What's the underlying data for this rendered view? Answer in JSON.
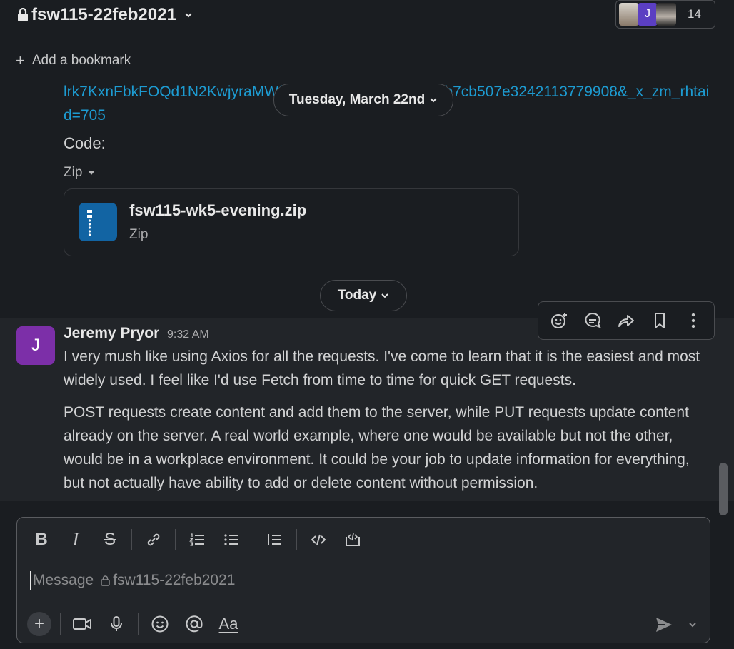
{
  "channel": {
    "name": "fsw115-22feb2021",
    "member_count": "14"
  },
  "bookmark": {
    "add_label": "Add a bookmark"
  },
  "messages_area": {
    "link_text": "lrk7KxnFbkFOQd1N2KwjyraMWfmd9995017fdf197a54c5b7cb507e3242113779908&_x_zm_rhtaid=705",
    "date_divider_1": "Tuesday, March 22nd",
    "code_label": "Code:",
    "attachment_kind": "Zip",
    "file": {
      "name": "fsw115-wk5-evening.zip",
      "type": "Zip"
    },
    "date_divider_2": "Today"
  },
  "message": {
    "avatar_initial": "J",
    "author": "Jeremy Pryor",
    "time": "9:32 AM",
    "paragraph_1": "I very mush like using Axios for all the requests. I've come to learn that it is the easiest and most widely used. I feel like I'd use Fetch from time to time for quick GET requests.",
    "paragraph_2": "POST requests create content and add them to the server, while PUT requests update content already on the server. A real world example, where one would be available but not the other, would be in a workplace environment. It could be your job to update information for everything, but not actually have ability to add or delete content without permission."
  },
  "composer": {
    "placeholder_prefix": "Message",
    "placeholder_channel": "fsw115-22feb2021",
    "format_label": "Aa"
  },
  "colors": {
    "background": "#1a1d21",
    "link": "#1d9bd1",
    "avatar": "#7c2fa8",
    "file_icon": "#1264a3"
  }
}
